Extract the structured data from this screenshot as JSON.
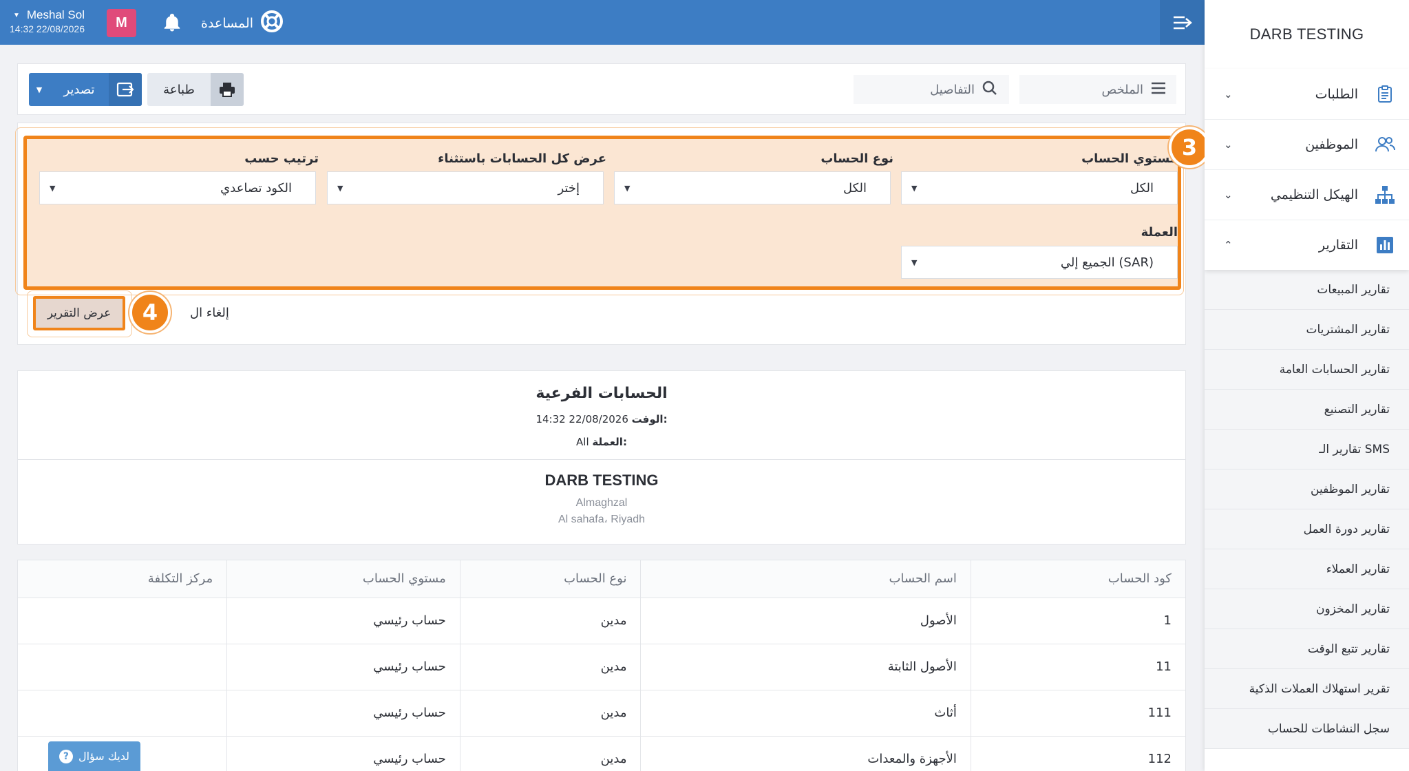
{
  "sidebar": {
    "brand": "DARB TESTING",
    "items": [
      {
        "label": "الطلبات",
        "icon": "clipboard-icon",
        "expanded": false
      },
      {
        "label": "الموظفين",
        "icon": "users-icon",
        "expanded": false
      },
      {
        "label": "الهيكل التنظيمي",
        "icon": "org-chart-icon",
        "expanded": false
      },
      {
        "label": "التقارير",
        "icon": "bar-chart-icon",
        "expanded": true
      }
    ],
    "sub_items": [
      "تقارير المبيعات",
      "تقارير المشتريات",
      "تقارير الحسابات العامة",
      "تقارير التصنيع",
      "تقارير الـ SMS",
      "تقارير الموظفين",
      "تقارير دورة العمل",
      "تقارير العملاء",
      "تقارير المخزون",
      "تقارير تتبع الوقت",
      "تقرير استهلاك العملات الذكية",
      "سجل النشاطات للحساب"
    ]
  },
  "topbar": {
    "user_name": "Meshal Sol",
    "datetime": "14:32 22/08/2026",
    "avatar_letter": "M",
    "help_label": "المساعدة"
  },
  "toolbar": {
    "export_label": "تصدير",
    "print_label": "طباعة",
    "details_label": "التفاصيل",
    "summary_label": "الملخص"
  },
  "filters": {
    "account_level_label": "مستوي الحساب",
    "account_level_value": "الكل",
    "account_type_label": "نوع الحساب",
    "account_type_value": "الكل",
    "exclude_label": "عرض كل الحسابات باستثناء",
    "exclude_value": "إختر",
    "sort_label": "ترتيب حسب",
    "sort_value": "الكود تصاعدي",
    "currency_label": "العملة",
    "currency_value": "الجميع إلي (SAR)",
    "step3": "3",
    "step4": "4",
    "show_report_label": "عرض التقرير",
    "cancel_label": "إلغاء ال"
  },
  "report": {
    "title": "الحسابات الفرعية",
    "time_label": "الوقت:",
    "time_value": "14:32 22/08/2026",
    "currency_label": "العملة:",
    "currency_value": "All",
    "company": "DARB TESTING",
    "address1": "Almaghzal",
    "address2": "Al sahafa، Riyadh"
  },
  "table": {
    "headers": [
      "كود الحساب",
      "اسم الحساب",
      "نوع الحساب",
      "مستوي الحساب",
      "مركز التكلفة"
    ],
    "rows": [
      [
        "1",
        "الأصول",
        "مدين",
        "حساب رئيسي",
        ""
      ],
      [
        "11",
        "الأصول الثابتة",
        "مدين",
        "حساب رئيسي",
        ""
      ],
      [
        "111",
        "أثاث",
        "مدين",
        "حساب رئيسي",
        ""
      ],
      [
        "112",
        "الأجهزة والمعدات",
        "مدين",
        "حساب رئيسي",
        ""
      ]
    ]
  },
  "help_widget": {
    "label": "لديك سؤال"
  },
  "colors": {
    "primary": "#3d7dc4",
    "highlight": "#f0841a",
    "highlight_fill": "#fbe6d3",
    "avatar": "#e04a7a"
  }
}
